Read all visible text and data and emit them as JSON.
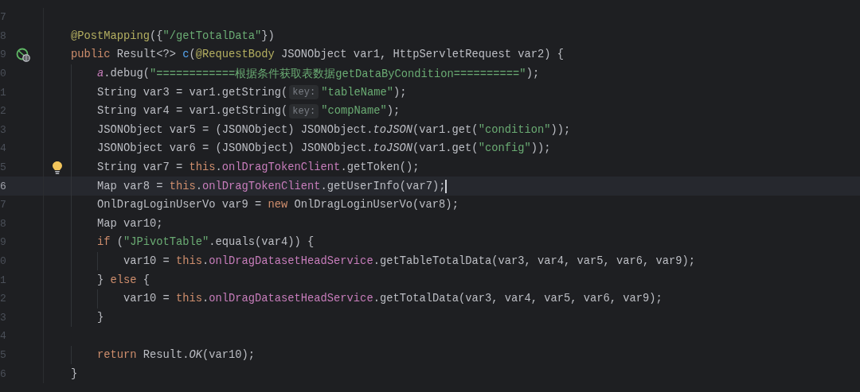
{
  "editor": {
    "lines": [
      {
        "number": "7",
        "current": false
      },
      {
        "number": "8",
        "current": false,
        "tokens": [
          {
            "kind": "annotation",
            "text": "    @PostMapping"
          },
          {
            "kind": "plain",
            "text": "({"
          },
          {
            "kind": "string",
            "text": "\"/getTotalData\""
          },
          {
            "kind": "plain",
            "text": "})"
          }
        ]
      },
      {
        "number": "9",
        "current": false,
        "marker": {
          "kind": "endpoint"
        },
        "tokens": [
          {
            "kind": "keyword",
            "text": "    public "
          },
          {
            "kind": "plain",
            "text": "Result<?> "
          },
          {
            "kind": "function",
            "text": "c"
          },
          {
            "kind": "plain",
            "text": "("
          },
          {
            "kind": "annotation",
            "text": "@RequestBody "
          },
          {
            "kind": "plain",
            "text": "JSONObject var1, HttpServletRequest var2) {"
          }
        ]
      },
      {
        "number": "0",
        "current": false,
        "tokens": [
          {
            "kind": "logger",
            "text": "        a"
          },
          {
            "kind": "plain",
            "text": ".debug("
          },
          {
            "kind": "string",
            "text": "\"============根据条件获取表数据getDataByCondition==========\""
          },
          {
            "kind": "plain",
            "text": ");"
          }
        ]
      },
      {
        "number": "1",
        "current": false,
        "tokens": [
          {
            "kind": "plain",
            "text": "        String var3 = var1.getString("
          },
          {
            "kind": "hint",
            "text": "key:"
          },
          {
            "kind": "string",
            "text": "\"tableName\""
          },
          {
            "kind": "plain",
            "text": ");"
          }
        ]
      },
      {
        "number": "2",
        "current": false,
        "tokens": [
          {
            "kind": "plain",
            "text": "        String var4 = var1.getString("
          },
          {
            "kind": "hint",
            "text": "key:"
          },
          {
            "kind": "string",
            "text": "\"compName\""
          },
          {
            "kind": "plain",
            "text": ");"
          }
        ]
      },
      {
        "number": "3",
        "current": false,
        "tokens": [
          {
            "kind": "plain",
            "text": "        JSONObject var5 = (JSONObject) JSONObject."
          },
          {
            "kind": "static",
            "text": "toJSON"
          },
          {
            "kind": "plain",
            "text": "(var1.get("
          },
          {
            "kind": "string",
            "text": "\"condition\""
          },
          {
            "kind": "plain",
            "text": "));"
          }
        ]
      },
      {
        "number": "4",
        "current": false,
        "tokens": [
          {
            "kind": "plain",
            "text": "        JSONObject var6 = (JSONObject) JSONObject."
          },
          {
            "kind": "static",
            "text": "toJSON"
          },
          {
            "kind": "plain",
            "text": "(var1.get("
          },
          {
            "kind": "string",
            "text": "\"config\""
          },
          {
            "kind": "plain",
            "text": "));"
          }
        ]
      },
      {
        "number": "5",
        "current": false,
        "marker": {
          "kind": "bulb"
        },
        "tokens": [
          {
            "kind": "plain",
            "text": "        String var7 = "
          },
          {
            "kind": "keyword",
            "text": "this"
          },
          {
            "kind": "plain",
            "text": "."
          },
          {
            "kind": "field",
            "text": "onlDragTokenClient"
          },
          {
            "kind": "plain",
            "text": ".getToken();"
          }
        ]
      },
      {
        "number": "6",
        "current": true,
        "tokens": [
          {
            "kind": "plain",
            "text": "        Map var8 = "
          },
          {
            "kind": "keyword",
            "text": "this"
          },
          {
            "kind": "plain",
            "text": "."
          },
          {
            "kind": "field",
            "text": "onlDragTokenClient"
          },
          {
            "kind": "plain",
            "text": ".getUserInfo(var7);"
          }
        ]
      },
      {
        "number": "7",
        "current": false,
        "tokens": [
          {
            "kind": "plain",
            "text": "        OnlDragLoginUserVo var9 = "
          },
          {
            "kind": "keyword",
            "text": "new "
          },
          {
            "kind": "plain",
            "text": "OnlDragLoginUserVo(var8);"
          }
        ]
      },
      {
        "number": "8",
        "current": false,
        "tokens": [
          {
            "kind": "plain",
            "text": "        Map var10;"
          }
        ]
      },
      {
        "number": "9",
        "current": false,
        "tokens": [
          {
            "kind": "keyword",
            "text": "        if "
          },
          {
            "kind": "plain",
            "text": "("
          },
          {
            "kind": "string",
            "text": "\"JPivotTable\""
          },
          {
            "kind": "plain",
            "text": ".equals(var4)) {"
          }
        ]
      },
      {
        "number": "0",
        "current": false,
        "tokens": [
          {
            "kind": "plain",
            "text": "            var10 = "
          },
          {
            "kind": "keyword",
            "text": "this"
          },
          {
            "kind": "plain",
            "text": "."
          },
          {
            "kind": "field",
            "text": "onlDragDatasetHeadService"
          },
          {
            "kind": "plain",
            "text": ".getTableTotalData(var3, var4, var5, var6, var9);"
          }
        ]
      },
      {
        "number": "1",
        "current": false,
        "tokens": [
          {
            "kind": "plain",
            "text": "        } "
          },
          {
            "kind": "keyword",
            "text": "else "
          },
          {
            "kind": "plain",
            "text": "{"
          }
        ]
      },
      {
        "number": "2",
        "current": false,
        "tokens": [
          {
            "kind": "plain",
            "text": "            var10 = "
          },
          {
            "kind": "keyword",
            "text": "this"
          },
          {
            "kind": "plain",
            "text": "."
          },
          {
            "kind": "field",
            "text": "onlDragDatasetHeadService"
          },
          {
            "kind": "plain",
            "text": ".getTotalData(var3, var4, var5, var6, var9);"
          }
        ]
      },
      {
        "number": "3",
        "current": false,
        "tokens": [
          {
            "kind": "plain",
            "text": "        }"
          }
        ]
      },
      {
        "number": "4",
        "current": false
      },
      {
        "number": "5",
        "current": false,
        "tokens": [
          {
            "kind": "keyword",
            "text": "        return "
          },
          {
            "kind": "plain",
            "text": "Result."
          },
          {
            "kind": "static",
            "text": "OK"
          },
          {
            "kind": "plain",
            "text": "(var10);"
          }
        ]
      },
      {
        "number": "6",
        "current": false,
        "tokens": [
          {
            "kind": "plain",
            "text": "    }"
          }
        ]
      }
    ]
  }
}
